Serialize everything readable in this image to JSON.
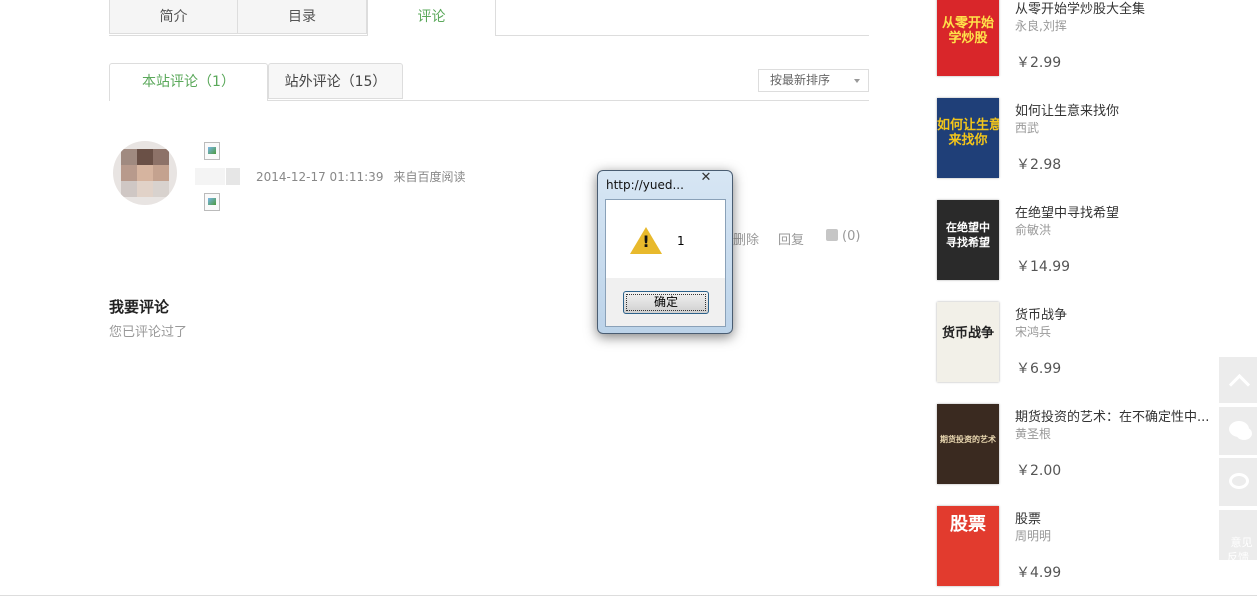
{
  "tabs": {
    "intro": "简介",
    "toc": "目录",
    "comments": "评论"
  },
  "comment_tabs": {
    "onsite": "本站评论（1）",
    "offsite": "站外评论（15）"
  },
  "sort": {
    "selected": "按最新排序"
  },
  "comment": {
    "date": "2014-12-17 01:11:39",
    "source": "来自百度阅读",
    "delete": "删除",
    "reply": "回复",
    "likes": "(0)"
  },
  "my_comment": {
    "title": "我要评论",
    "note": "您已评论过了"
  },
  "dialog": {
    "title": "http://yued...",
    "message": "1",
    "ok": "确定",
    "close": "✕"
  },
  "books": [
    {
      "title": "从零开始学炒股大全集",
      "author": "永良,刘挥",
      "price": "￥2.99",
      "cover_text": "从零开始\n学炒股",
      "cover_color": "#d9262a",
      "text_color": "#ffe24a"
    },
    {
      "title": "如何让生意来找你",
      "author": "西武",
      "price": "￥2.98",
      "cover_text": "如何让生意\n来找你",
      "cover_color": "#1f3f78",
      "text_color": "#f3c51a"
    },
    {
      "title": "在绝望中寻找希望",
      "author": "俞敏洪",
      "price": "￥14.99",
      "cover_text": "在绝望中\n寻找希望",
      "cover_color": "#2a2a2a",
      "text_color": "#ffffff"
    },
    {
      "title": "货币战争",
      "author": "宋鸿兵",
      "price": "￥6.99",
      "cover_text": "货币战争",
      "cover_color": "#f2f0e8",
      "text_color": "#222222"
    },
    {
      "title": "期货投资的艺术：在不确定性中...",
      "author": "黄圣根",
      "price": "￥2.00",
      "cover_text": "期货投资的艺术",
      "cover_color": "#3a2a20",
      "text_color": "#e9d7b0"
    },
    {
      "title": "股票",
      "author": "周明明",
      "price": "￥4.99",
      "cover_text": "股票",
      "cover_color": "#e23b2e",
      "text_color": "#ffffff"
    }
  ],
  "float_bar": {
    "feedback": "意见\n反馈"
  }
}
